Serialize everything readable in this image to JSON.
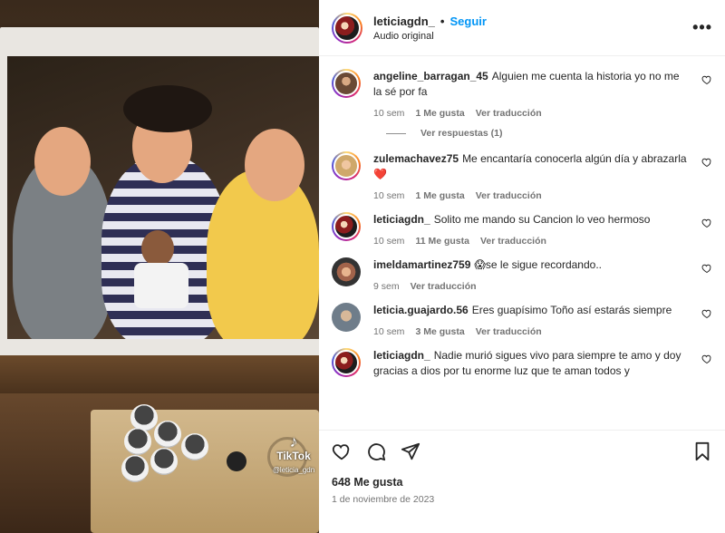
{
  "media": {
    "tiktok_label": "TikTok",
    "tiktok_handle": "@leticia_gdn"
  },
  "header": {
    "username": "leticiagdn_",
    "separator": "•",
    "follow_label": "Seguir",
    "subtitle": "Audio original",
    "more_icon": "more-horizontal-icon"
  },
  "comments": [
    {
      "username": "angeline_barragan_45",
      "text": "Alguien me cuenta la historia yo no me la sé por fa",
      "time": "10 sem",
      "likes": "1 Me gusta",
      "translate": "Ver traducción",
      "avatar": "av-brown",
      "ring": true
    },
    {
      "username": "zulemachavez75",
      "text": "Me encantaría conocerla algún día y abrazarla ❤️",
      "time": "10 sem",
      "likes": "1 Me gusta",
      "translate": "Ver traducción",
      "avatar": "av-blonde",
      "ring": true
    },
    {
      "username": "leticiagdn_",
      "text": "Solito me mando su Cancion lo veo hermoso",
      "time": "10 sem",
      "likes": "11 Me gusta",
      "translate": "Ver traducción",
      "avatar": "av-red",
      "ring": true
    },
    {
      "username": "imeldamartinez759",
      "text": "😱se le sigue recordando..",
      "time": "9 sem",
      "likes": "",
      "translate": "Ver traducción",
      "avatar": "av-party",
      "ring": false
    },
    {
      "username": "leticia.guajardo.56",
      "text": "Eres guapísimo Toño así estarás siempre",
      "time": "10 sem",
      "likes": "3 Me gusta",
      "translate": "Ver traducción",
      "avatar": "av-sand",
      "ring": false
    },
    {
      "username": "leticiagdn_",
      "text": "Nadie murió sigues vivo para siempre te amo y doy gracias a dios por tu enorme luz que te aman todos y",
      "time": "",
      "likes": "",
      "translate": "",
      "avatar": "av-red",
      "ring": true
    }
  ],
  "replies_label": "Ver respuestas (1)",
  "actions": {
    "likes_count": "648 Me gusta",
    "date": "1 de noviembre de 2023"
  },
  "colors": {
    "accent": "#0095f6",
    "muted": "#737373",
    "text": "#262626"
  }
}
